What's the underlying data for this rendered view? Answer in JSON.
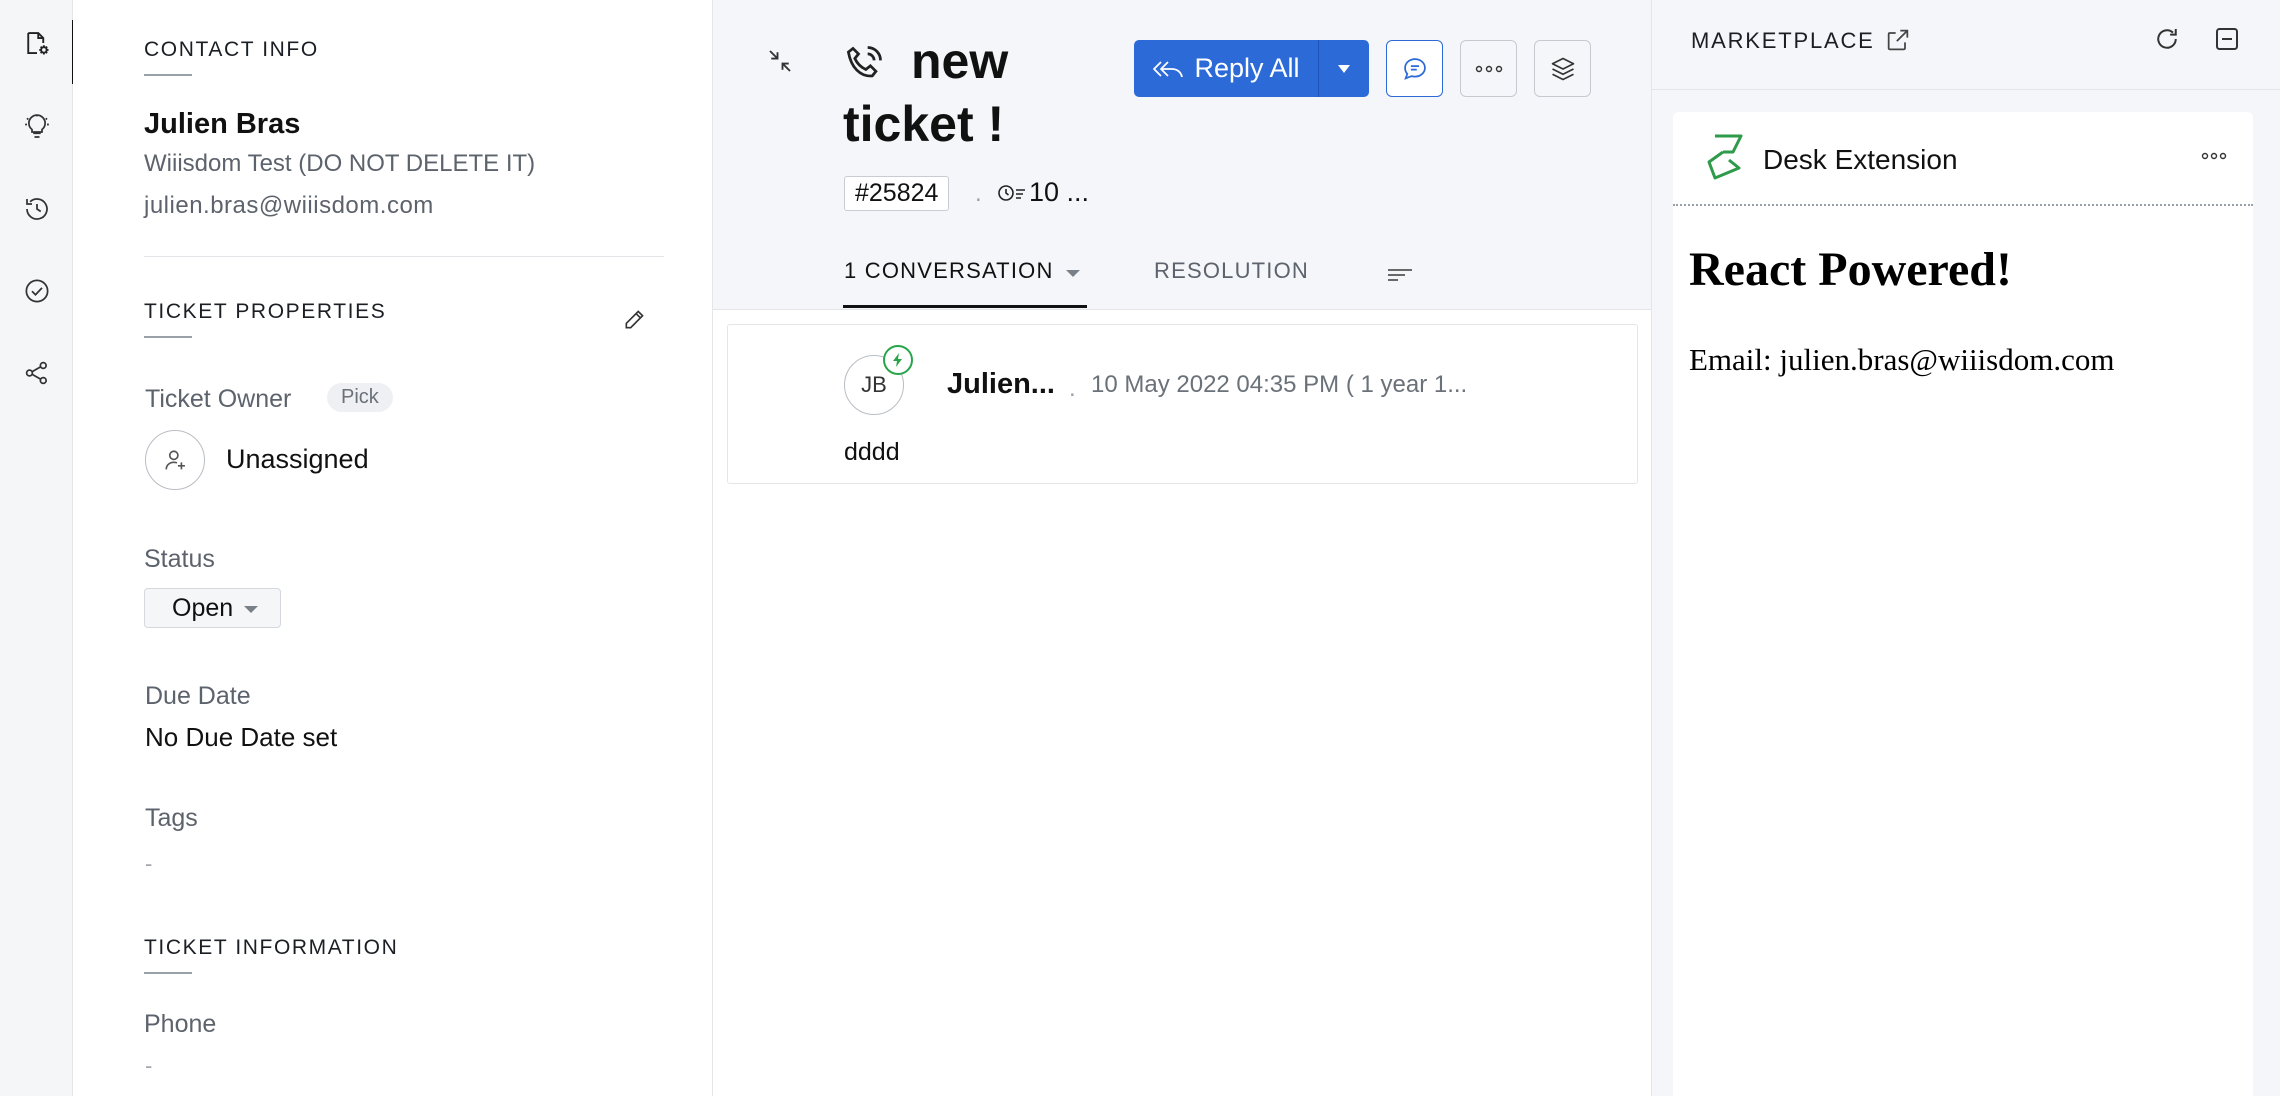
{
  "rail": {
    "items": [
      {
        "name": "ticket-properties-icon",
        "active": true
      },
      {
        "name": "ai-bulb-icon",
        "active": false
      },
      {
        "name": "history-icon",
        "active": false
      },
      {
        "name": "check-circle-icon",
        "active": false
      },
      {
        "name": "share-icon",
        "active": false
      }
    ]
  },
  "contact": {
    "section_title": "CONTACT INFO",
    "name": "Julien Bras",
    "account": "Wiiisdom Test (DO NOT DELETE IT)",
    "email": "julien.bras@wiiisdom.com"
  },
  "ticket_properties": {
    "section_title": "TICKET PROPERTIES",
    "owner_label": "Ticket Owner",
    "pick_label": "Pick",
    "owner_value": "Unassigned",
    "status_label": "Status",
    "status_value": "Open",
    "due_date_label": "Due Date",
    "due_date_value": "No Due Date set",
    "tags_label": "Tags",
    "tags_value": "-"
  },
  "ticket_information": {
    "section_title": "TICKET INFORMATION",
    "phone_label": "Phone",
    "phone_value": "-"
  },
  "header": {
    "title": "new ticket !",
    "ticket_number": "#25824",
    "separator": ".",
    "timer_text": "10 ...",
    "reply_all_label": "Reply All"
  },
  "tabs": {
    "conversation_label": "1 CONVERSATION",
    "resolution_label": "RESOLUTION"
  },
  "thread": {
    "avatar_initials": "JB",
    "author": "Julien...",
    "separator": ".",
    "timestamp": "10 May 2022 04:35 PM ( 1 year 1...",
    "body": "dddd"
  },
  "marketplace": {
    "title": "MARKETPLACE",
    "extension_name": "Desk Extension",
    "heading": "React Powered!",
    "email_line": "Email: julien.bras@wiiisdom.com"
  },
  "colors": {
    "accent_blue": "#2c6ad8",
    "success_green": "#27a54a",
    "panel_bg": "#f4f6f9"
  }
}
